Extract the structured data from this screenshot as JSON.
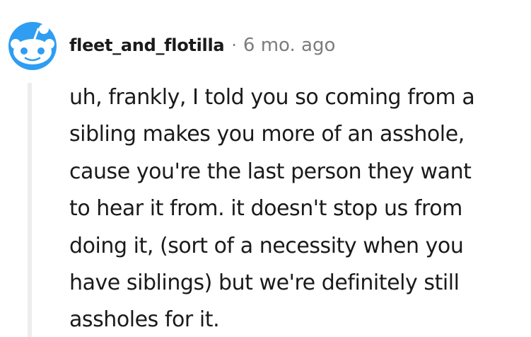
{
  "comment": {
    "author": "fleet_and_flotilla",
    "separator": "·",
    "timestamp": "6 mo. ago",
    "body_lines": [
      "uh, frankly, I told you so coming from a",
      "sibling makes you more of an asshole,",
      "cause you're the last person they want",
      "to hear it from. it doesn't stop us from",
      "doing it, (sort of a necessity when you",
      "have siblings) but we're definitely still",
      "assholes for it."
    ]
  },
  "avatar": {
    "icon": "reddit-snoo-avatar-icon",
    "background_color": "#2E9DF2",
    "face_color": "#FFFFFF",
    "eye_color": "#2E9DF2"
  },
  "colors": {
    "text": "#1A1A1B",
    "meta": "#7C7C7C",
    "thread_line": "#EDEDED"
  }
}
